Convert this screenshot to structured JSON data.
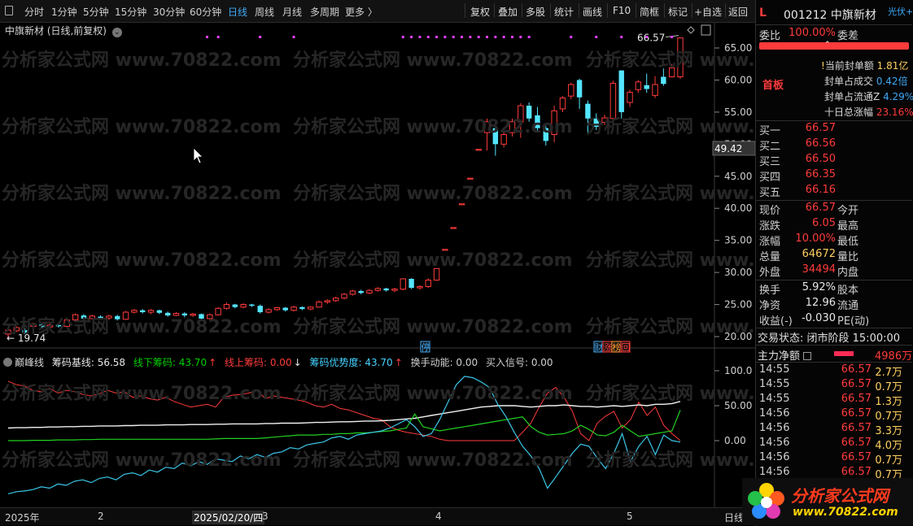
{
  "toolbar": {
    "periods": [
      "分时",
      "1分钟",
      "5分钟",
      "15分钟",
      "30分钟",
      "60分钟",
      "日线",
      "周线",
      "月线",
      "多周期",
      "更多 〉"
    ],
    "active_period": "日线",
    "actions": [
      "复权",
      "叠加",
      "多股",
      "统计",
      "画线",
      "F10",
      "简框",
      "标记",
      "+自选",
      "返回"
    ]
  },
  "chart": {
    "title": "中旗新材 (日线,前复权)",
    "high_label": "66.57",
    "low_label": "19.74",
    "cursor_price": "49.42",
    "price_ticks": [
      "65.00",
      "60.00",
      "55.00",
      "50.00",
      "45.00",
      "40.00",
      "35.00",
      "30.00",
      "25.00",
      "20.00"
    ],
    "events": [
      "停",
      "财",
      "涨",
      "榜",
      "回"
    ]
  },
  "indicator": {
    "name": "巅峰线",
    "base_label": "筹码基线: 56.58",
    "under_label": "线下筹码: 43.70",
    "above_label": "线上筹码: 0.00",
    "advantage_label": "筹码优势度: 43.70",
    "turnover_label": "换手动能: 0.00",
    "buy_label": "买入信号: 0.00",
    "ticks": [
      "100.0",
      "50.00",
      "0.00"
    ]
  },
  "xaxis": {
    "labels": [
      "2025年",
      "2",
      "2025/02/20/四",
      "3",
      "4",
      "5"
    ],
    "period": "日线"
  },
  "watermark": "分析家公式网 www.70822.com",
  "right_panel": {
    "code": "L",
    "stock_code": "001212",
    "stock_name": "中旗新材",
    "side_tag": "光伏+石",
    "webi_label": "委比",
    "webi_value": "100.00%",
    "weicha_label": "委差",
    "first_board": "首板",
    "stats": [
      {
        "label": "当前封单额",
        "value": "1.81亿"
      },
      {
        "label": "封单占成交",
        "value": "0.42倍"
      },
      {
        "label": "封单占流通Z",
        "value": "4.29%"
      },
      {
        "label": "十日总涨幅",
        "value": "23.16%"
      }
    ],
    "bids": [
      {
        "label": "买一",
        "price": "66.57"
      },
      {
        "label": "买二",
        "price": "66.56"
      },
      {
        "label": "买三",
        "price": "66.50"
      },
      {
        "label": "买四",
        "price": "66.35"
      },
      {
        "label": "买五",
        "price": "66.16"
      }
    ],
    "quote": [
      {
        "label": "现价",
        "value": "66.57",
        "label2": "今开"
      },
      {
        "label": "涨跌",
        "value": "6.05",
        "label2": "最高"
      },
      {
        "label": "涨幅",
        "value": "10.00%",
        "label2": "最低"
      },
      {
        "label": "总量",
        "value": "64672",
        "label2": "量比"
      },
      {
        "label": "外盘",
        "value": "34494",
        "label2": "内盘"
      }
    ],
    "quote2": [
      {
        "label": "换手",
        "value": "5.92%",
        "label2": "股本"
      },
      {
        "label": "净资",
        "value": "12.96",
        "label2": "流通"
      },
      {
        "label": "收益(-)",
        "value": "-0.030",
        "label2": "PE(动)"
      }
    ],
    "trade_status": "交易状态: 闭市阶段 15:00:00",
    "main_flow_label": "主力净额",
    "main_flow_value": "4986万",
    "ticks": [
      {
        "time": "14:55",
        "price": "66.57",
        "vol": "2.7万"
      },
      {
        "time": "14:55",
        "price": "66.57",
        "vol": "0.7万"
      },
      {
        "time": "14:55",
        "price": "66.57",
        "vol": "1.3万"
      },
      {
        "time": "14:56",
        "price": "66.57",
        "vol": "0.7万"
      },
      {
        "time": "14:56",
        "price": "66.57",
        "vol": "3.3万"
      },
      {
        "time": "14:56",
        "price": "66.57",
        "vol": "4.0万"
      },
      {
        "time": "14:56",
        "price": "66.57",
        "vol": "0.7万"
      },
      {
        "time": "14:56",
        "price": "66.57",
        "vol": "0.7万"
      }
    ]
  },
  "logo": {
    "title": "分析家公式网",
    "url": "www.70822.com"
  },
  "colors": {
    "up": "#ff3b3b",
    "down": "#54e6ff",
    "accent": "#3fa9f5",
    "limit_dot": "#e040fb"
  }
}
